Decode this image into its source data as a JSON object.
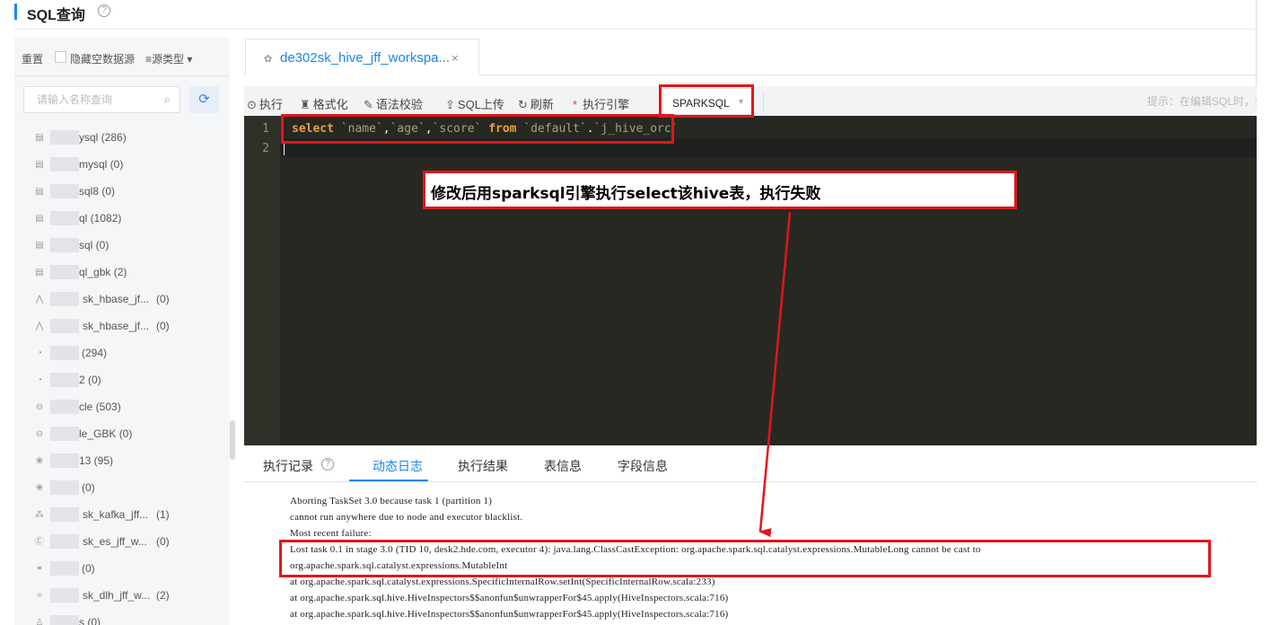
{
  "header": {
    "title": "SQL查询",
    "help": "?"
  },
  "sidebar": {
    "reset_label": "重置",
    "hide_empty_label": "隐藏空数据源",
    "source_type_label": "≡源类型 ▾",
    "search_placeholder": "请输入名称查询",
    "items": [
      {
        "icon": "db-icon",
        "label": "ysql (286)"
      },
      {
        "icon": "db-icon",
        "label": "mysql (0)"
      },
      {
        "icon": "db-icon",
        "label": "sql8 (0)"
      },
      {
        "icon": "db-icon",
        "label": "ql (1082)"
      },
      {
        "icon": "db-icon",
        "label": "sql (0)"
      },
      {
        "icon": "db-icon",
        "label": "ql_gbk (2)"
      },
      {
        "icon": "hbase-icon",
        "label": "sk_hbase_jf...",
        "count": "(0)"
      },
      {
        "icon": "hbase-icon",
        "label": "sk_hbase_jf...",
        "count": "(0)"
      },
      {
        "icon": "gauge-icon",
        "label": "(294)"
      },
      {
        "icon": "gauge-icon",
        "label": "2 (0)"
      },
      {
        "icon": "oracle-icon",
        "label": "cle (503)"
      },
      {
        "icon": "oracle-icon",
        "label": "le_GBK (0)"
      },
      {
        "icon": "hive-icon",
        "label": "13 (95)"
      },
      {
        "icon": "hive-icon",
        "label": "(0)"
      },
      {
        "icon": "kafka-icon",
        "label": "sk_kafka_jff...",
        "count": "(1)"
      },
      {
        "icon": "es-icon",
        "label": "sk_es_jff_w...",
        "count": "(0)"
      },
      {
        "icon": "link-icon",
        "label": "(0)"
      },
      {
        "icon": "dlh-icon",
        "label": "sk_dlh_jff_w...",
        "count": "(2)"
      },
      {
        "icon": "user-icon",
        "label": "s (0)"
      }
    ]
  },
  "tab": {
    "label": "de302sk_hive_jff_workspa...",
    "close": "×"
  },
  "toolbar": {
    "run": "执行",
    "format": "格式化",
    "syntax_check": "语法校验",
    "sql_upload": "SQL上传",
    "refresh": "刷新",
    "engine_label": "执行引擎",
    "engine_value": "SPARKSQL",
    "hint": "提示：在编辑SQL时，如"
  },
  "editor": {
    "line_numbers": [
      "1",
      "2"
    ],
    "tokens": [
      {
        "t": "select",
        "c": "kw2"
      },
      {
        "t": " ",
        "c": "pun"
      },
      {
        "t": "`name`",
        "c": "str"
      },
      {
        "t": ",",
        "c": "pun"
      },
      {
        "t": "`age`",
        "c": "str"
      },
      {
        "t": ",",
        "c": "pun"
      },
      {
        "t": "`score`",
        "c": "str"
      },
      {
        "t": " ",
        "c": "pun"
      },
      {
        "t": "from",
        "c": "kw2"
      },
      {
        "t": " ",
        "c": "pun"
      },
      {
        "t": "`default`",
        "c": "str"
      },
      {
        "t": ".",
        "c": "pun"
      },
      {
        "t": "`j_hive_orc`",
        "c": "str"
      }
    ]
  },
  "annotation": {
    "callout": "修改后用sparksql引擎执行select该hive表，执行失败"
  },
  "bottom_tabs": {
    "history": "执行记录",
    "live_log": "动态日志",
    "result": "执行结果",
    "table_info": "表信息",
    "field_info": "字段信息"
  },
  "log_lines": [
    "Aborting TaskSet 3.0 because task 1 (partition 1)",
    "cannot run anywhere due to node and executor blacklist.",
    "Most recent failure:",
    "Lost task 0.1 in stage 3.0 (TID 10, desk2.hde.com, executor 4): java.lang.ClassCastException: org.apache.spark.sql.catalyst.expressions.MutableLong cannot be cast to",
    "org.apache.spark.sql.catalyst.expressions.MutableInt",
    "at org.apache.spark.sql.catalyst.expressions.SpecificInternalRow.setInt(SpecificInternalRow.scala:233)",
    "at org.apache.spark.sql.hive.HiveInspectors$$anonfun$unwrapperFor$45.apply(HiveInspectors.scala:716)",
    "at org.apache.spark.sql.hive.HiveInspectors$$anonfun$unwrapperFor$45.apply(HiveInspectors.scala:716)"
  ],
  "colors": {
    "accent": "#1a86f2",
    "annotation_red": "#e0161c",
    "editor_bg": "#272822"
  }
}
